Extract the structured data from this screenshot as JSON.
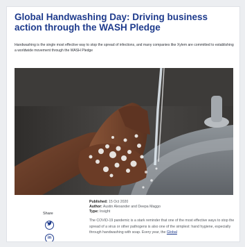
{
  "article": {
    "title": "Global Handwashing Day: Driving business action through the WASH Pledge",
    "lede": "Handwashing is the single most effective way to stop the spread of infections, and many companies like Xylem are committed to establishing a worldwide movement through the WASH Pledge",
    "meta": {
      "published_label": "Published:",
      "published_value": "15 Oct 2020",
      "author_label": "Author:",
      "author_value": "Austin Alexander and Deepa Maggo",
      "type_label": "Type:",
      "type_value": "Insight"
    },
    "body": "The COVID-19 pandemic is a stark reminder that one of the most effective ways to stop the spread of a virus or other pathogens is also one of the simplest: hand hygiene, especially through handwashing with soap. Every year, the",
    "body_link": "Global"
  },
  "share": {
    "label": "Share",
    "twitter_icon": "twitter-icon",
    "linkedin_icon": "linkedin-icon"
  },
  "colors": {
    "accent": "#1d3a8c",
    "page_bg": "#eceef1"
  }
}
